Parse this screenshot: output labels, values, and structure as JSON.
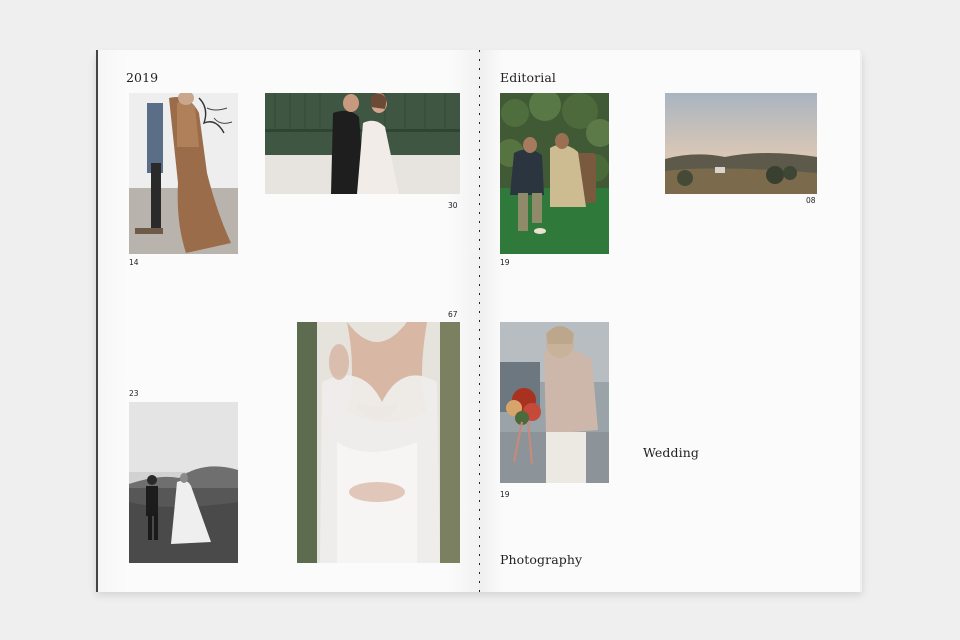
{
  "left_page": {
    "header": "2019",
    "photos": [
      {
        "number": "14",
        "icon": "street-couple-photo"
      },
      {
        "number": "30",
        "icon": "wedding-couple-wall-photo"
      },
      {
        "number": "23",
        "icon": "bw-couple-hills-photo"
      },
      {
        "number": "67",
        "icon": "bride-veil-photo"
      }
    ]
  },
  "right_page": {
    "header": "Editorial",
    "label_wedding": "Wedding",
    "label_photography": "Photography",
    "photos": [
      {
        "number": "19",
        "icon": "couple-on-grass-photo"
      },
      {
        "number": "08",
        "icon": "landscape-sunset-photo"
      },
      {
        "number": "19",
        "icon": "bride-with-bouquet-photo"
      }
    ]
  }
}
